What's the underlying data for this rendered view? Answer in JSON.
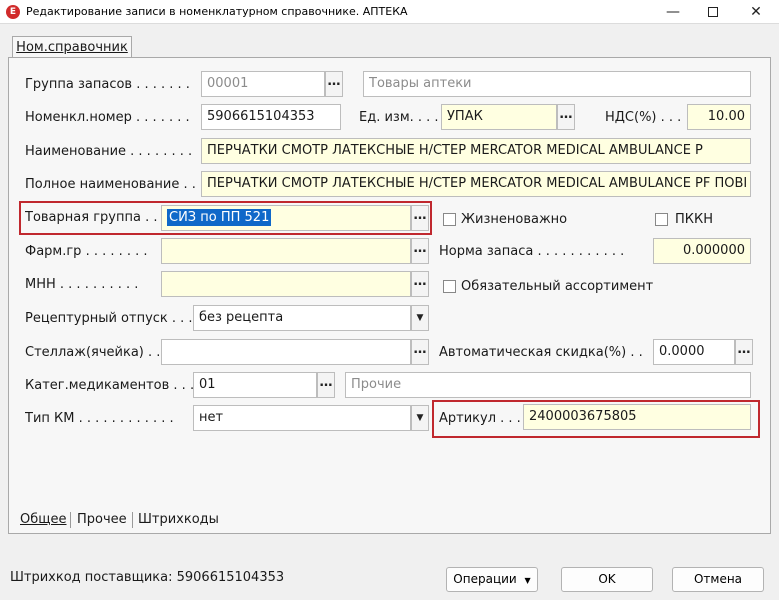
{
  "window": {
    "title": "Редактирование записи в номенклатурном справочнике. АПТЕКА",
    "icon_letter": "Е",
    "minimize_glyph": "—",
    "close_glyph": "✕"
  },
  "top_tab": {
    "label": "Ном.справочник"
  },
  "form": {
    "stock_group_label": "Группа запасов . . . . . . .",
    "stock_group_code": "00001",
    "stock_group_name": "Товары аптеки",
    "nomen_number_label": "Номенкл.номер . . . . . . .",
    "nomen_number": "5906615104353",
    "unit_label": "Ед. изм. . . .",
    "unit_value": "УПАК",
    "vat_label": "НДС(%) . . .",
    "vat_value": "10.00",
    "name_label": "Наименование . . . . . . . .",
    "name_value": "ПЕРЧАТКИ СМОТР ЛАТЕКСНЫЕ Н/СТЕР MERCATOR MEDICAL AMBULANCE P",
    "fullname_label": "Полное наименование . . .",
    "fullname_value": "ПЕРЧАТКИ СМОТР ЛАТЕКСНЫЕ Н/СТЕР MERCATOR MEDICAL AMBULANCE PF ПОВІ",
    "product_group_label": "Товарная группа . .",
    "product_group_value": "СИЗ по ПП 521",
    "vital_label": "Жизненоважно",
    "pkkn_label": "ПККН",
    "pharm_group_label": "Фарм.гр . . . . . . . .",
    "pharm_group_value": "",
    "stock_norm_label": "Норма запаса . . . . . . . . . . .",
    "stock_norm_value": "0.000000",
    "mnn_label": "МНН . . . . . . . . . .",
    "mnn_value": "",
    "mandatory_label": "Обязательный ассортимент",
    "prescription_label": "Рецептурный отпуск . . .",
    "prescription_value": "без рецепта",
    "rack_label": "Стеллаж(ячейка) . .",
    "rack_value": "",
    "auto_discount_label": "Автоматическая скидка(%) . .",
    "auto_discount_value": "0.0000",
    "med_category_label": "Катег.медикаментов . . .",
    "med_category_code": "01",
    "med_category_name": "Прочие",
    "km_type_label": "Тип КМ . . . . . . . . . . . .",
    "km_type_value": "нет",
    "article_label": "Артикул . . .",
    "article_value": "2400003675805"
  },
  "bottom_tabs": [
    {
      "label": "Общее"
    },
    {
      "label": "Прочее"
    },
    {
      "label": "Штрихкоды"
    }
  ],
  "footer": {
    "supplier_barcode": "Штрихкод поставщика: 5906615104353",
    "operations_label": "Операции",
    "ok_label": "OK",
    "cancel_label": "Отмена"
  },
  "icons": {
    "lookup": "…",
    "dropdown": "▼"
  },
  "colors": {
    "highlight_red": "#c0282e",
    "input_yellow": "#ffffe1",
    "selection_blue": "#0f68c9"
  }
}
